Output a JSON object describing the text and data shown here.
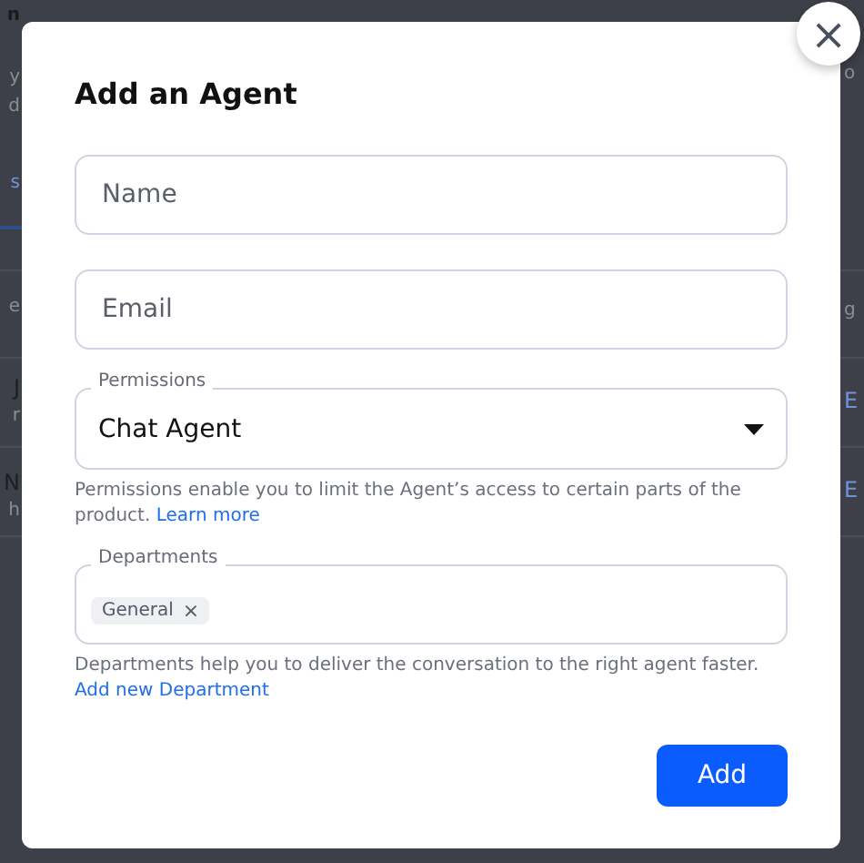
{
  "background": {
    "left": [
      {
        "text": "n",
        "kind": "heading"
      },
      {
        "text": "y",
        "kind": "muted"
      },
      {
        "text": "d",
        "kind": "muted"
      },
      {
        "text": "s",
        "kind": "tab"
      },
      {
        "text": "e",
        "kind": "muted"
      },
      {
        "text": "J",
        "kind": "name"
      },
      {
        "text": "r",
        "kind": "muted"
      },
      {
        "text": "N",
        "kind": "name"
      },
      {
        "text": "h",
        "kind": "muted"
      }
    ],
    "right": [
      {
        "text": "o",
        "kind": "muted"
      },
      {
        "text": "g",
        "kind": "muted"
      },
      {
        "text": "E",
        "kind": "link"
      },
      {
        "text": "E",
        "kind": "link"
      }
    ]
  },
  "close_button": {
    "label": "×"
  },
  "dialog": {
    "title": "Add an Agent",
    "fields": [
      {
        "kind": "text",
        "placeholder": "Name"
      },
      {
        "kind": "text",
        "placeholder": "Email"
      },
      {
        "kind": "select",
        "label": "Permissions",
        "value": "Chat Agent",
        "help": "Permissions enable you to limit the Agent’s access to certain parts of the product.",
        "link": "Learn more"
      },
      {
        "kind": "tags",
        "label": "Departments",
        "tags": [
          {
            "label": "General",
            "remove": "×"
          }
        ],
        "help": "Departments help you to deliver the conversation to the right agent faster.",
        "link": "Add new Department"
      }
    ],
    "submit": "Add"
  }
}
